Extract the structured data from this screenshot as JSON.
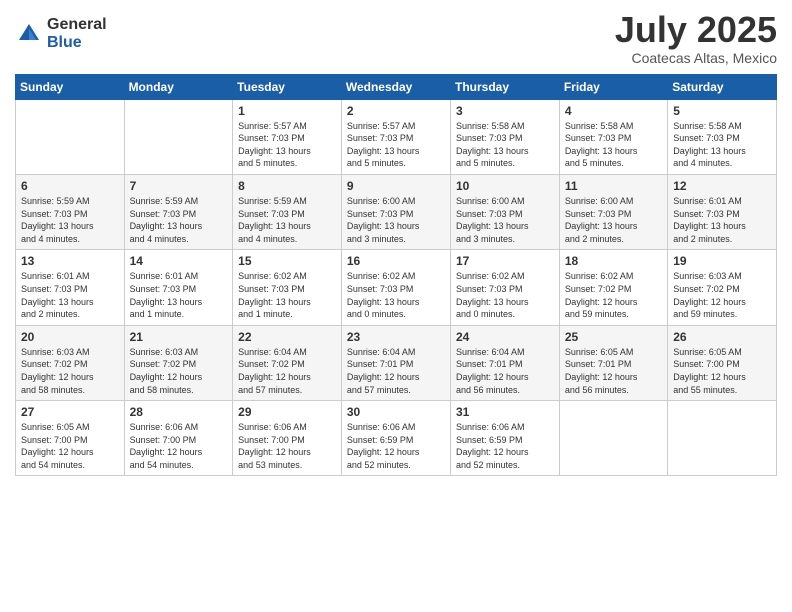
{
  "logo": {
    "general": "General",
    "blue": "Blue"
  },
  "title": {
    "month_year": "July 2025",
    "location": "Coatecas Altas, Mexico"
  },
  "days_of_week": [
    "Sunday",
    "Monday",
    "Tuesday",
    "Wednesday",
    "Thursday",
    "Friday",
    "Saturday"
  ],
  "weeks": [
    [
      {
        "day": "",
        "info": ""
      },
      {
        "day": "",
        "info": ""
      },
      {
        "day": "1",
        "info": "Sunrise: 5:57 AM\nSunset: 7:03 PM\nDaylight: 13 hours\nand 5 minutes."
      },
      {
        "day": "2",
        "info": "Sunrise: 5:57 AM\nSunset: 7:03 PM\nDaylight: 13 hours\nand 5 minutes."
      },
      {
        "day": "3",
        "info": "Sunrise: 5:58 AM\nSunset: 7:03 PM\nDaylight: 13 hours\nand 5 minutes."
      },
      {
        "day": "4",
        "info": "Sunrise: 5:58 AM\nSunset: 7:03 PM\nDaylight: 13 hours\nand 5 minutes."
      },
      {
        "day": "5",
        "info": "Sunrise: 5:58 AM\nSunset: 7:03 PM\nDaylight: 13 hours\nand 4 minutes."
      }
    ],
    [
      {
        "day": "6",
        "info": "Sunrise: 5:59 AM\nSunset: 7:03 PM\nDaylight: 13 hours\nand 4 minutes."
      },
      {
        "day": "7",
        "info": "Sunrise: 5:59 AM\nSunset: 7:03 PM\nDaylight: 13 hours\nand 4 minutes."
      },
      {
        "day": "8",
        "info": "Sunrise: 5:59 AM\nSunset: 7:03 PM\nDaylight: 13 hours\nand 4 minutes."
      },
      {
        "day": "9",
        "info": "Sunrise: 6:00 AM\nSunset: 7:03 PM\nDaylight: 13 hours\nand 3 minutes."
      },
      {
        "day": "10",
        "info": "Sunrise: 6:00 AM\nSunset: 7:03 PM\nDaylight: 13 hours\nand 3 minutes."
      },
      {
        "day": "11",
        "info": "Sunrise: 6:00 AM\nSunset: 7:03 PM\nDaylight: 13 hours\nand 2 minutes."
      },
      {
        "day": "12",
        "info": "Sunrise: 6:01 AM\nSunset: 7:03 PM\nDaylight: 13 hours\nand 2 minutes."
      }
    ],
    [
      {
        "day": "13",
        "info": "Sunrise: 6:01 AM\nSunset: 7:03 PM\nDaylight: 13 hours\nand 2 minutes."
      },
      {
        "day": "14",
        "info": "Sunrise: 6:01 AM\nSunset: 7:03 PM\nDaylight: 13 hours\nand 1 minute."
      },
      {
        "day": "15",
        "info": "Sunrise: 6:02 AM\nSunset: 7:03 PM\nDaylight: 13 hours\nand 1 minute."
      },
      {
        "day": "16",
        "info": "Sunrise: 6:02 AM\nSunset: 7:03 PM\nDaylight: 13 hours\nand 0 minutes."
      },
      {
        "day": "17",
        "info": "Sunrise: 6:02 AM\nSunset: 7:03 PM\nDaylight: 13 hours\nand 0 minutes."
      },
      {
        "day": "18",
        "info": "Sunrise: 6:02 AM\nSunset: 7:02 PM\nDaylight: 12 hours\nand 59 minutes."
      },
      {
        "day": "19",
        "info": "Sunrise: 6:03 AM\nSunset: 7:02 PM\nDaylight: 12 hours\nand 59 minutes."
      }
    ],
    [
      {
        "day": "20",
        "info": "Sunrise: 6:03 AM\nSunset: 7:02 PM\nDaylight: 12 hours\nand 58 minutes."
      },
      {
        "day": "21",
        "info": "Sunrise: 6:03 AM\nSunset: 7:02 PM\nDaylight: 12 hours\nand 58 minutes."
      },
      {
        "day": "22",
        "info": "Sunrise: 6:04 AM\nSunset: 7:02 PM\nDaylight: 12 hours\nand 57 minutes."
      },
      {
        "day": "23",
        "info": "Sunrise: 6:04 AM\nSunset: 7:01 PM\nDaylight: 12 hours\nand 57 minutes."
      },
      {
        "day": "24",
        "info": "Sunrise: 6:04 AM\nSunset: 7:01 PM\nDaylight: 12 hours\nand 56 minutes."
      },
      {
        "day": "25",
        "info": "Sunrise: 6:05 AM\nSunset: 7:01 PM\nDaylight: 12 hours\nand 56 minutes."
      },
      {
        "day": "26",
        "info": "Sunrise: 6:05 AM\nSunset: 7:00 PM\nDaylight: 12 hours\nand 55 minutes."
      }
    ],
    [
      {
        "day": "27",
        "info": "Sunrise: 6:05 AM\nSunset: 7:00 PM\nDaylight: 12 hours\nand 54 minutes."
      },
      {
        "day": "28",
        "info": "Sunrise: 6:06 AM\nSunset: 7:00 PM\nDaylight: 12 hours\nand 54 minutes."
      },
      {
        "day": "29",
        "info": "Sunrise: 6:06 AM\nSunset: 7:00 PM\nDaylight: 12 hours\nand 53 minutes."
      },
      {
        "day": "30",
        "info": "Sunrise: 6:06 AM\nSunset: 6:59 PM\nDaylight: 12 hours\nand 52 minutes."
      },
      {
        "day": "31",
        "info": "Sunrise: 6:06 AM\nSunset: 6:59 PM\nDaylight: 12 hours\nand 52 minutes."
      },
      {
        "day": "",
        "info": ""
      },
      {
        "day": "",
        "info": ""
      }
    ]
  ]
}
